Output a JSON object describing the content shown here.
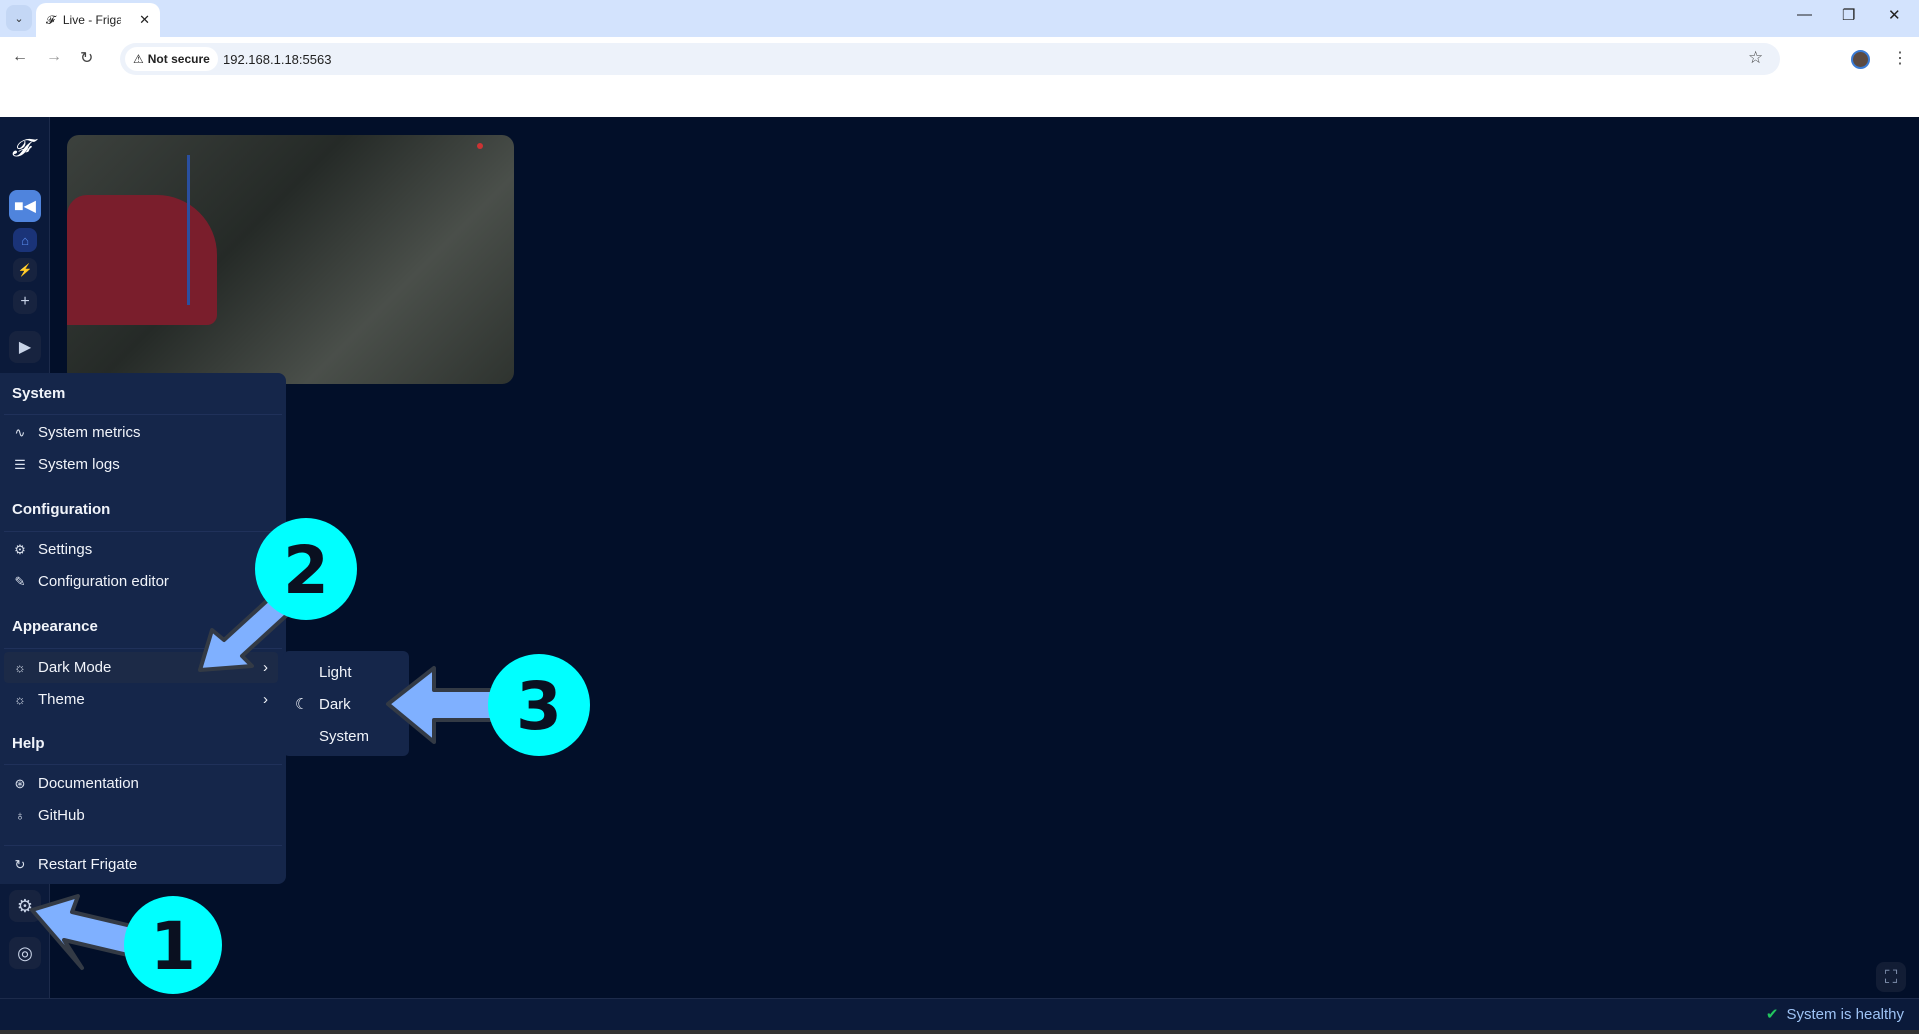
{
  "browser": {
    "tab_title": "Live - Frigate",
    "not_secure": "Not secure",
    "url": "192.168.1.18:5563"
  },
  "menu": {
    "sections": [
      {
        "title": "System",
        "items": [
          {
            "label": "System metrics",
            "icon": "activity-icon"
          },
          {
            "label": "System logs",
            "icon": "list-icon"
          }
        ]
      },
      {
        "title": "Configuration",
        "items": [
          {
            "label": "Settings",
            "icon": "gear-icon"
          },
          {
            "label": "Configuration editor",
            "icon": "edit-icon"
          }
        ]
      },
      {
        "title": "Appearance",
        "items": [
          {
            "label": "Dark Mode",
            "icon": "sun-icon"
          },
          {
            "label": "Theme",
            "icon": "sun-icon"
          }
        ]
      },
      {
        "title": "Help",
        "items": [
          {
            "label": "Documentation",
            "icon": "lifebuoy-icon"
          },
          {
            "label": "GitHub",
            "icon": "github-icon"
          }
        ]
      }
    ],
    "restart": "Restart Frigate"
  },
  "dark_mode_submenu": {
    "options": [
      "Light",
      "Dark",
      "System"
    ],
    "selected": "Dark"
  },
  "status": {
    "text": "System is healthy",
    "color": "#22c55e"
  },
  "annotations": {
    "step1": "1",
    "step2": "2",
    "step3": "3",
    "circle_color": "#00ffff",
    "arrow_color": "#7fb0ff"
  }
}
